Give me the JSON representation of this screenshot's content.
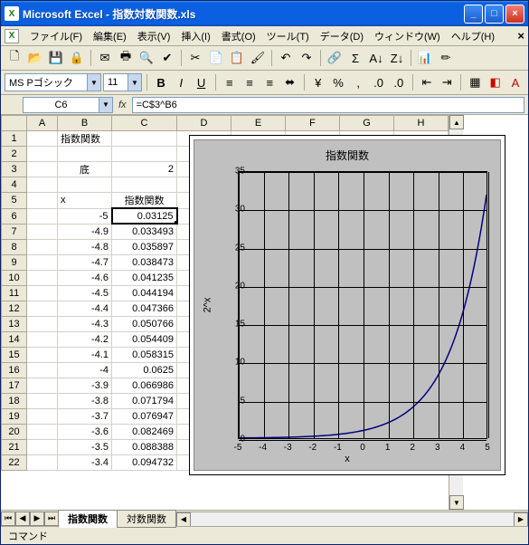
{
  "title": "Microsoft Excel - 指数対数関数.xls",
  "menu": [
    "ファイル(F)",
    "編集(E)",
    "表示(V)",
    "挿入(I)",
    "書式(O)",
    "ツール(T)",
    "データ(D)",
    "ウィンドウ(W)",
    "ヘルプ(H)"
  ],
  "font": {
    "name": "MS Pゴシック",
    "size": "11"
  },
  "namebox": "C6",
  "formula": "=C$3^B6",
  "columns": [
    "A",
    "B",
    "C",
    "D",
    "E",
    "F",
    "G",
    "H"
  ],
  "cells": {
    "B1": "指数関数",
    "B3": "底",
    "C3": "2",
    "B5": "x",
    "C5": "指数関数"
  },
  "rows": [
    {
      "r": 6,
      "x": "-5",
      "y": "0.03125"
    },
    {
      "r": 7,
      "x": "-4.9",
      "y": "0.033493"
    },
    {
      "r": 8,
      "x": "-4.8",
      "y": "0.035897"
    },
    {
      "r": 9,
      "x": "-4.7",
      "y": "0.038473"
    },
    {
      "r": 10,
      "x": "-4.6",
      "y": "0.041235"
    },
    {
      "r": 11,
      "x": "-4.5",
      "y": "0.044194"
    },
    {
      "r": 12,
      "x": "-4.4",
      "y": "0.047366"
    },
    {
      "r": 13,
      "x": "-4.3",
      "y": "0.050766"
    },
    {
      "r": 14,
      "x": "-4.2",
      "y": "0.054409"
    },
    {
      "r": 15,
      "x": "-4.1",
      "y": "0.058315"
    },
    {
      "r": 16,
      "x": "-4",
      "y": "0.0625"
    },
    {
      "r": 17,
      "x": "-3.9",
      "y": "0.066986"
    },
    {
      "r": 18,
      "x": "-3.8",
      "y": "0.071794"
    },
    {
      "r": 19,
      "x": "-3.7",
      "y": "0.076947"
    },
    {
      "r": 20,
      "x": "-3.6",
      "y": "0.082469"
    },
    {
      "r": 21,
      "x": "-3.5",
      "y": "0.088388"
    },
    {
      "r": 22,
      "x": "-3.4",
      "y": "0.094732"
    }
  ],
  "sheet_tabs": [
    "指数関数",
    "対数関数"
  ],
  "active_tab": 0,
  "status": "コマンド",
  "chart_data": {
    "type": "line",
    "title": "指数関数",
    "xlabel": "x",
    "ylabel": "2^x",
    "xlim": [
      -5,
      5
    ],
    "ylim": [
      0,
      35
    ],
    "xticks": [
      -5,
      -4,
      -3,
      -2,
      -1,
      0,
      1,
      2,
      3,
      4,
      5
    ],
    "yticks": [
      0,
      5,
      10,
      15,
      20,
      25,
      30,
      35
    ],
    "series": [
      {
        "name": "2^x",
        "x": [
          -5,
          -4,
          -3,
          -2,
          -1,
          0,
          1,
          2,
          3,
          4,
          5
        ],
        "y": [
          0.03125,
          0.0625,
          0.125,
          0.25,
          0.5,
          1,
          2,
          4,
          8,
          16,
          32
        ]
      }
    ]
  }
}
